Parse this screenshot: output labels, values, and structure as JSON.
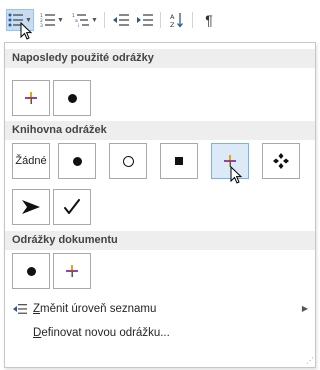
{
  "toolbar": {
    "sort_label": "A Z",
    "pilcrow": "¶"
  },
  "sections": {
    "recent": "Naposledy použité odrážky",
    "library": "Knihovna odrážek",
    "document": "Odrážky dokumentu"
  },
  "library": {
    "none_label": "Žádné"
  },
  "menu": {
    "change_level": {
      "hotkey": "Z",
      "rest": "měnit úroveň seznamu"
    },
    "define_new": {
      "hotkey": "D",
      "rest": "efinovat novou odrážku..."
    }
  },
  "colors": {
    "accent_selected_bg": "#dceaf8",
    "accent_selected_border": "#7fb0e2",
    "section_header_bg": "#eeeeee"
  }
}
